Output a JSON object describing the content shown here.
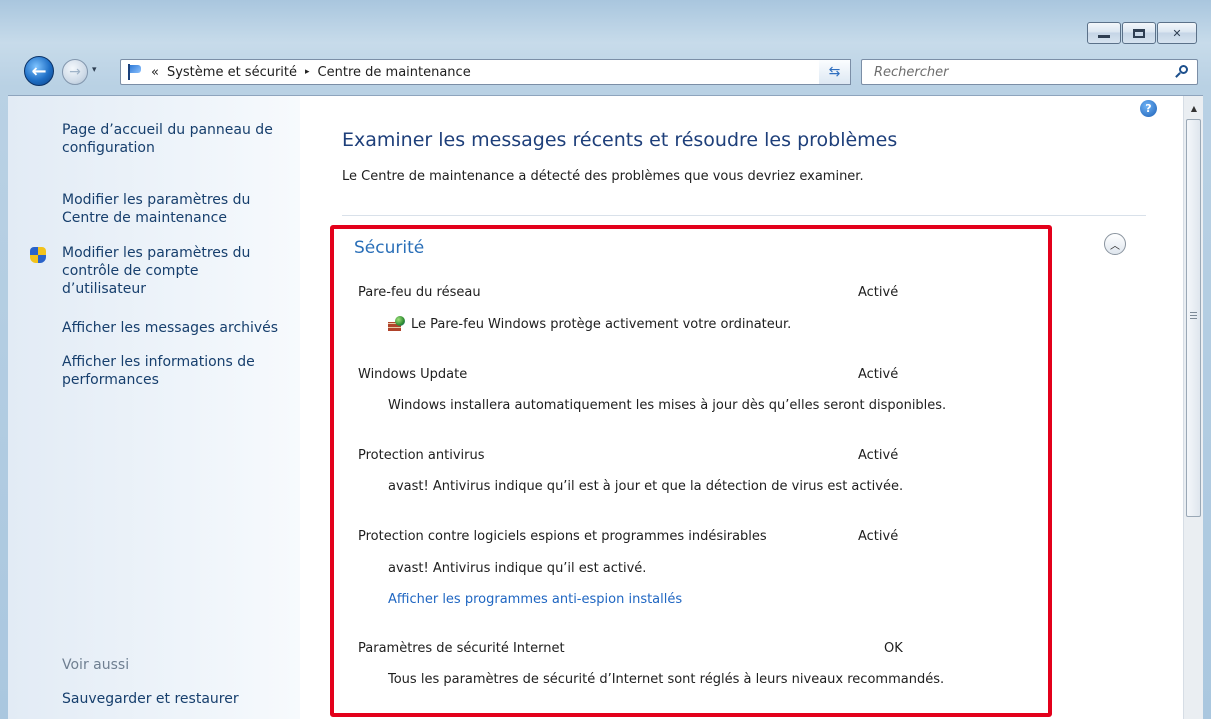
{
  "window": {
    "caption_buttons": [
      "minimize",
      "maximize",
      "close"
    ]
  },
  "navigation": {
    "history_glyph": "▾",
    "address": {
      "prefix": "«",
      "crumbs": [
        "Système et sécurité",
        "Centre de maintenance"
      ],
      "separator": "▸",
      "dropdown_glyph": "▾"
    },
    "search": {
      "placeholder": "Rechercher"
    }
  },
  "sidebar": {
    "links": [
      {
        "label_1": "Page d’accueil du panneau de",
        "label_2": "configuration"
      },
      {
        "label_1": "Modifier les paramètres du",
        "label_2": "Centre de maintenance"
      },
      {
        "label_1": "Modifier les paramètres du",
        "label_2": "contrôle de compte",
        "label_3": "d’utilisateur",
        "icon": "shield-icon"
      },
      {
        "label_1": "Afficher les messages archivés"
      },
      {
        "label_1": "Afficher les informations de",
        "label_2": "performances"
      }
    ],
    "see_also": {
      "heading": "Voir aussi",
      "links": [
        "Sauvegarder et restaurer"
      ]
    }
  },
  "main": {
    "help_glyph": "?",
    "title": "Examiner les messages récents et résoudre les problèmes",
    "description": "Le Centre de maintenance a détecté des problèmes que vous devriez examiner.",
    "security": {
      "heading": "Sécurité",
      "collapse_glyph": "︿",
      "items": [
        {
          "label": "Pare-feu du réseau",
          "status": "Activé",
          "detail": "Le Pare-feu Windows protège activement votre ordinateur."
        },
        {
          "label": "Windows Update",
          "status": "Activé",
          "detail": "Windows installera automatiquement les mises à jour dès qu’elles seront disponibles."
        },
        {
          "label": "Protection antivirus",
          "status": "Activé",
          "detail": "avast! Antivirus indique qu’il est à jour et que la détection de virus est activée."
        },
        {
          "label": "Protection contre logiciels espions et programmes indésirables",
          "status": "Activé",
          "detail": "avast! Antivirus indique qu’il est activé.",
          "link": "Afficher les programmes anti-espion installés"
        },
        {
          "label": "Paramètres de sécurité Internet",
          "status": "OK",
          "detail": "Tous les paramètres de sécurité d’Internet sont réglés à leurs niveaux recommandés."
        }
      ]
    }
  },
  "colors": {
    "highlight_border": "#e3001b",
    "heading_blue": "#2a6fb8",
    "link_blue": "#1f66c2",
    "sidebar_link": "#173f6d"
  }
}
